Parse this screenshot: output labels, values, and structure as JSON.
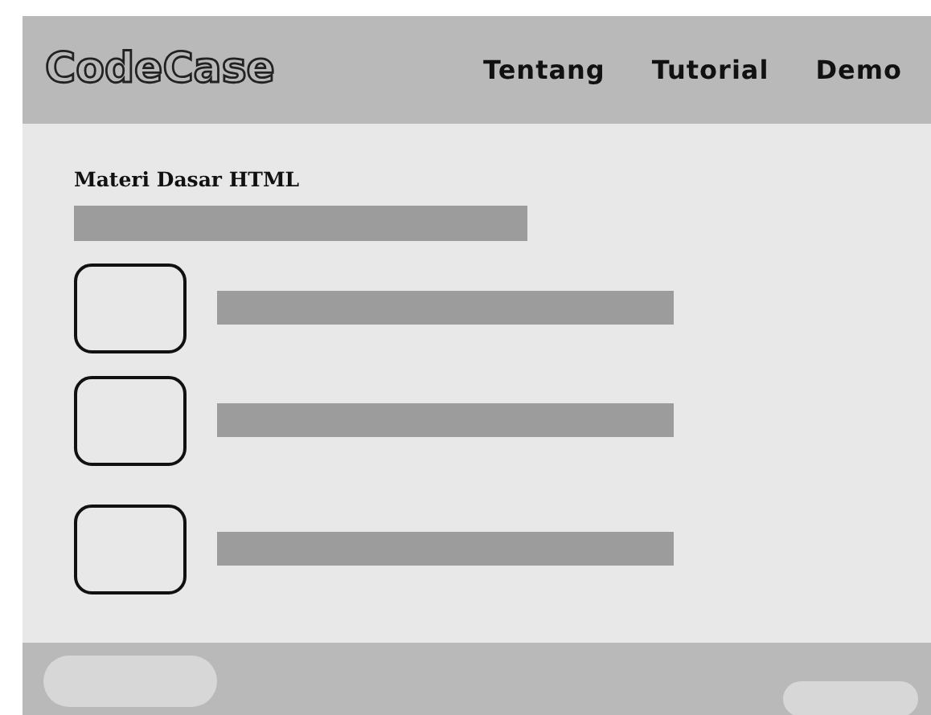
{
  "header": {
    "logo": "CodeCase",
    "nav": [
      {
        "label": "Tentang"
      },
      {
        "label": "Tutorial"
      },
      {
        "label": "Demo"
      }
    ]
  },
  "content": {
    "title": "Materi Dasar HTML",
    "lessons": [
      {
        "kind": "thumbnail-row"
      },
      {
        "kind": "thumbnail-row"
      },
      {
        "kind": "thumbnail-row"
      }
    ]
  },
  "footer": {
    "buttons": [
      {
        "kind": "pill"
      },
      {
        "kind": "pill-small"
      }
    ]
  }
}
